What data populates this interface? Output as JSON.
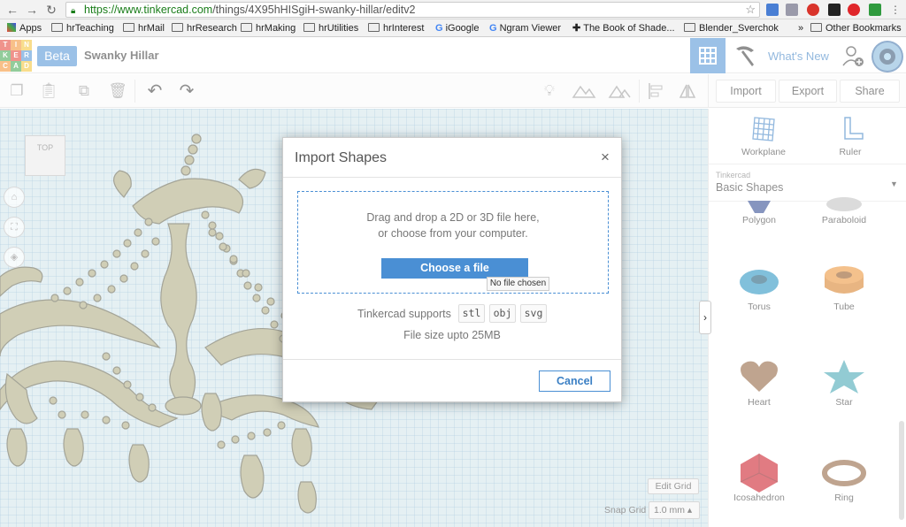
{
  "browser": {
    "url_host": "https://www.tinkercad.com",
    "url_path": "/things/4X95hHISgiH-swanky-hillar/editv2",
    "bookmarks": [
      "Apps",
      "hrTeaching",
      "hrMail",
      "hrResearch",
      "hrMaking",
      "hrUtilities",
      "hrInterest",
      "iGoogle",
      "Ngram Viewer",
      "The Book of Shade...",
      "Blender_Sverchok",
      "Other Bookmarks"
    ],
    "bookmarks_more": "»"
  },
  "app": {
    "logo_letters": [
      "TIN",
      "KER",
      "CAD"
    ],
    "beta_label": "Beta",
    "project_name": "Swanky Hillar",
    "whats_new": "What's New",
    "accent_color": "#4a8fd4"
  },
  "toolbar": {
    "import": "Import",
    "export": "Export",
    "share": "Share"
  },
  "workspace": {
    "viewcube_label": "TOP",
    "edit_grid": "Edit Grid",
    "snap_grid_label": "Snap Grid",
    "snap_grid_value": "1.0 mm ▴"
  },
  "panel": {
    "workplane": "Workplane",
    "ruler": "Ruler",
    "source": "Tinkercad",
    "library": "Basic Shapes",
    "shapes": [
      "Polygon",
      "Paraboloid",
      "Torus",
      "Tube",
      "Heart",
      "Star",
      "Icosahedron",
      "Ring"
    ]
  },
  "modal": {
    "title": "Import Shapes",
    "close": "×",
    "drop_line1": "Drag and drop a 2D or 3D file here,",
    "drop_line2": "or choose from your computer.",
    "choose_button": "Choose a file",
    "no_file": "No file chosen",
    "supports_label": "Tinkercad supports",
    "formats": [
      "stl",
      "obj",
      "svg"
    ],
    "file_size": "File size upto 25MB",
    "cancel": "Cancel"
  }
}
